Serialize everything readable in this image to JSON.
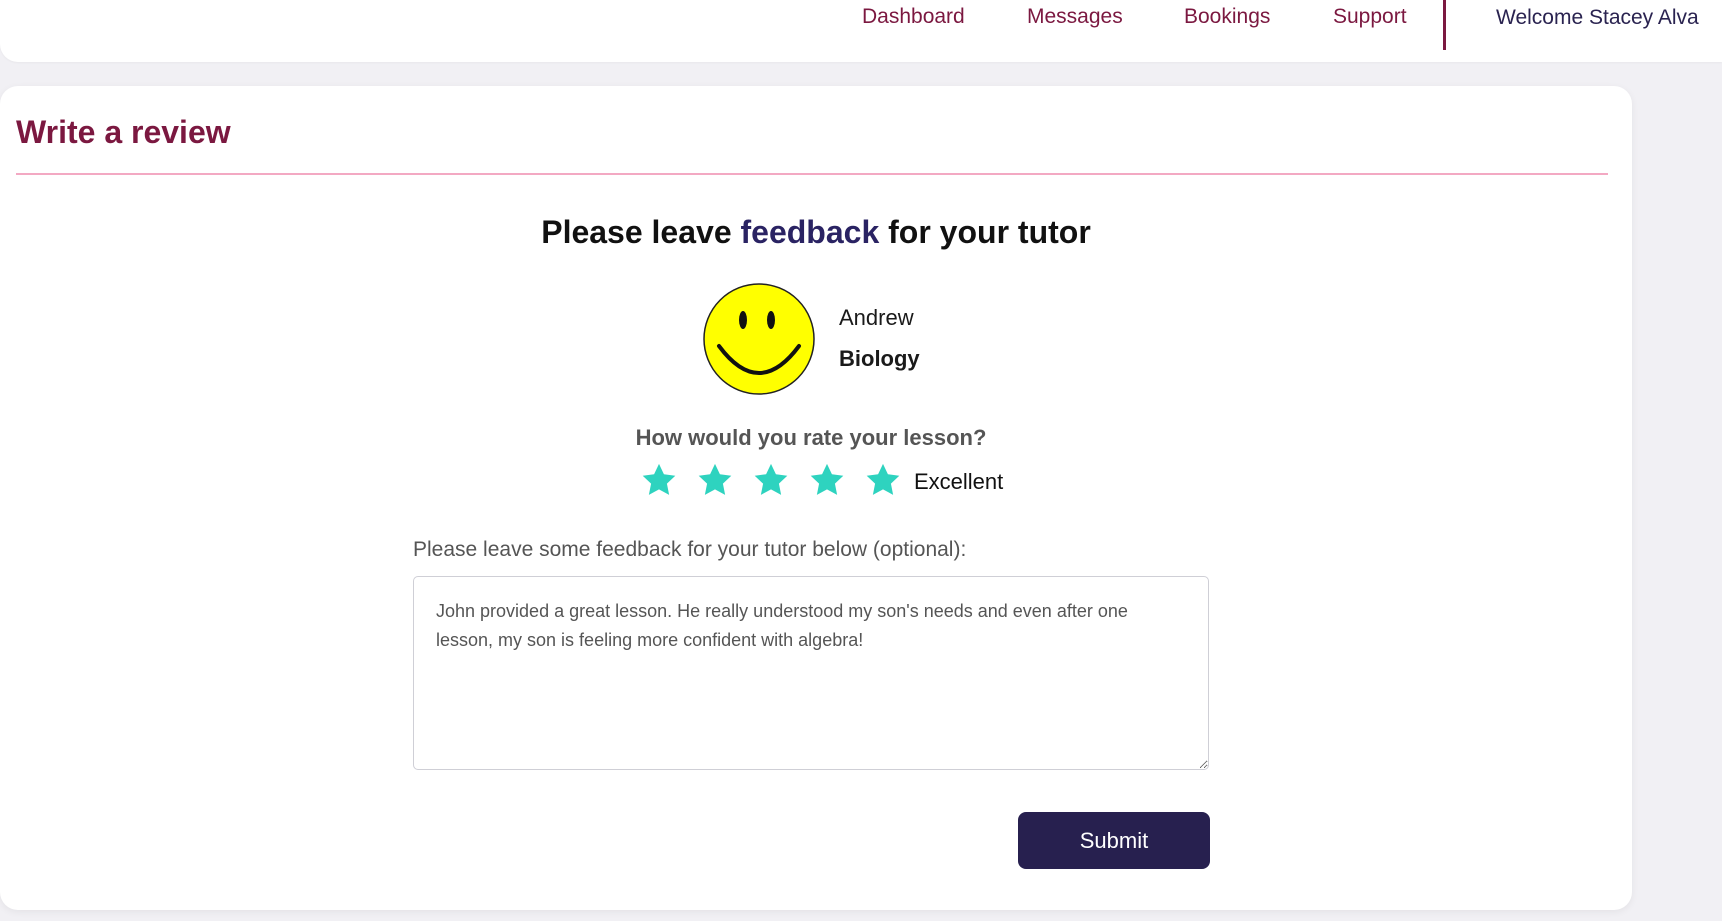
{
  "nav": {
    "links": [
      {
        "label": "Dashboard"
      },
      {
        "label": "Messages"
      },
      {
        "label": "Bookings"
      },
      {
        "label": "Support"
      }
    ],
    "welcome": "Welcome Stacey Alva"
  },
  "page": {
    "title": "Write a review"
  },
  "review": {
    "heading_before": "Please leave ",
    "heading_accent": "feedback",
    "heading_after": " for your tutor",
    "tutor_name": "Andrew",
    "tutor_subject": "Biology",
    "avatar_icon": "smiley-face-icon",
    "rate_question": "How would you rate your lesson?",
    "rating": 5,
    "rating_max": 5,
    "rating_label": "Excellent",
    "feedback_label": "Please leave some feedback for your tutor below (optional):",
    "feedback_text": "John provided a great lesson. He really understood my son's needs and even after one lesson, my son is feeling more confident with algebra!",
    "submit_label": "Submit"
  },
  "colors": {
    "brand": "#7b1840",
    "accent_navy": "#27204f",
    "star": "#2ed3bf",
    "rule": "#f3a9c3"
  }
}
